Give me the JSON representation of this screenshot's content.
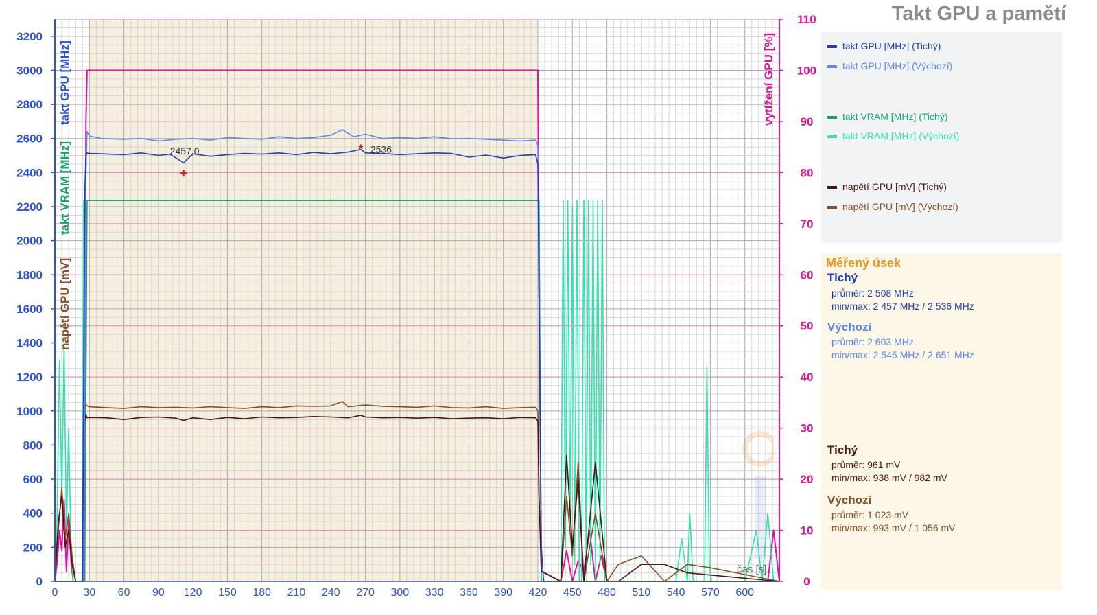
{
  "title": "Takt GPU a pamětí",
  "colors": {
    "quiet_clock": "#1f3fb0",
    "default_clock": "#5b85ef",
    "quiet_vram": "#16a06f",
    "default_vram": "#2ee3b0",
    "quiet_voltage": "#4a1410",
    "default_voltage": "#8a4d23",
    "utilization": "#e0129a",
    "left_axis": "#2a52d8",
    "right_axis": "#e0129a",
    "stats_heading": "#f0931e"
  },
  "legend": [
    {
      "label": "takt GPU [MHz] (Tichý)",
      "color": "#1f3fb0"
    },
    {
      "label": "takt GPU [MHz] (Výchozí)",
      "color": "#5b85ef"
    },
    {
      "label": "takt VRAM [MHz] (Tichý)",
      "color": "#16a06f"
    },
    {
      "label": "takt VRAM [MHz] (Výchozí)",
      "color": "#2ee3b0"
    },
    {
      "label": "napětí GPU [mV] (Tichý)",
      "color": "#4a1410"
    },
    {
      "label": "napětí GPU [mV] (Výchozí)",
      "color": "#8a4d23"
    }
  ],
  "stats": {
    "heading": "Měřený úsek",
    "clock_quiet": {
      "name": "Tichý",
      "avg": "průměr: 2 508 MHz",
      "minmax": "min/max: 2 457 MHz / 2 536 MHz"
    },
    "clock_default": {
      "name": "Výchozí",
      "avg": "průměr: 2 603 MHz",
      "minmax": "min/max: 2 545 MHz / 2 651 MHz"
    },
    "volt_quiet": {
      "name": "Tichý",
      "avg": "průměr: 961 mV",
      "minmax": "min/max: 938 mV / 982 mV"
    },
    "volt_default": {
      "name": "Výchozí",
      "avg": "průměr: 1 023 mV",
      "minmax": "min/max: 993 mV / 1 056 mV"
    }
  },
  "chart_data": {
    "type": "line",
    "x_label": "čas [s]",
    "xlim": [
      0,
      630
    ],
    "x_ticks": [
      0,
      30,
      60,
      90,
      120,
      150,
      180,
      210,
      240,
      270,
      300,
      330,
      360,
      390,
      420,
      450,
      480,
      510,
      540,
      570,
      600
    ],
    "y_left": {
      "labels": [
        "takt GPU [MHz]",
        "takt VRAM [MHz]",
        "napětí GPU [mV]"
      ],
      "ylim": [
        0,
        3300
      ],
      "ticks": [
        0,
        200,
        400,
        600,
        800,
        1000,
        1200,
        1400,
        1600,
        1800,
        2000,
        2200,
        2400,
        2600,
        2800,
        3000,
        3200
      ]
    },
    "y_right": {
      "label": "vytížení GPU [%]",
      "ylim": [
        0,
        110
      ],
      "ticks": [
        0,
        10,
        20,
        30,
        40,
        50,
        60,
        70,
        80,
        90,
        100,
        110
      ]
    },
    "measured_interval": [
      29,
      420
    ],
    "annotations": [
      {
        "text": "2457,0",
        "x": 112,
        "y": 2457
      },
      {
        "text": "2536",
        "x": 266,
        "y": 2536
      }
    ],
    "series": [
      {
        "name": "takt GPU [MHz] (Tichý)",
        "axis": "left",
        "x": [
          0,
          24,
          26,
          27,
          28,
          30,
          40,
          60,
          75,
          90,
          100,
          112,
          120,
          135,
          150,
          165,
          180,
          195,
          210,
          225,
          240,
          255,
          266,
          270,
          285,
          300,
          315,
          330,
          345,
          360,
          375,
          390,
          405,
          418,
          420,
          421,
          423,
          425,
          630
        ],
        "y": [
          0,
          0,
          2300,
          2500,
          2515,
          2512,
          2510,
          2505,
          2515,
          2500,
          2508,
          2457,
          2510,
          2495,
          2505,
          2512,
          2508,
          2515,
          2505,
          2518,
          2510,
          2520,
          2536,
          2515,
          2512,
          2505,
          2510,
          2515,
          2512,
          2490,
          2502,
          2485,
          2500,
          2505,
          2450,
          1700,
          200,
          0,
          0
        ]
      },
      {
        "name": "takt GPU [MHz] (Výchozí)",
        "axis": "left",
        "x": [
          0,
          25,
          27,
          28,
          30,
          40,
          60,
          75,
          90,
          105,
          120,
          135,
          150,
          165,
          180,
          195,
          210,
          225,
          240,
          250,
          260,
          270,
          285,
          300,
          315,
          330,
          345,
          360,
          375,
          390,
          405,
          418,
          420,
          421,
          423,
          425,
          630
        ],
        "y": [
          0,
          0,
          2400,
          2640,
          2615,
          2600,
          2595,
          2600,
          2585,
          2595,
          2600,
          2590,
          2605,
          2600,
          2595,
          2610,
          2600,
          2605,
          2620,
          2651,
          2610,
          2625,
          2600,
          2605,
          2600,
          2610,
          2598,
          2600,
          2595,
          2590,
          2585,
          2590,
          2560,
          1700,
          200,
          0,
          0
        ]
      },
      {
        "name": "takt VRAM [MHz] (Tichý)",
        "axis": "left",
        "x": [
          0,
          26,
          28,
          30,
          100,
          200,
          300,
          419,
          421,
          423,
          630
        ],
        "y": [
          0,
          0,
          2236,
          2236,
          2236,
          2236,
          2236,
          2236,
          2236,
          0,
          0
        ]
      },
      {
        "name": "takt VRAM [MHz] (Výchozí)",
        "axis": "left",
        "x": [
          0,
          2,
          4,
          6,
          8,
          10,
          12,
          14,
          16,
          18,
          24,
          25,
          27,
          28,
          30,
          419,
          421,
          423,
          440,
          442,
          444,
          446,
          448,
          450,
          452,
          454,
          456,
          458,
          460,
          462,
          464,
          466,
          468,
          470,
          472,
          474,
          476,
          478,
          480,
          540,
          545,
          550,
          552,
          555,
          560,
          565,
          567,
          569,
          571,
          575,
          600,
          610,
          615,
          620,
          625,
          630
        ],
        "y": [
          0,
          400,
          1300,
          500,
          1380,
          300,
          900,
          200,
          0,
          0,
          0,
          2236,
          2236,
          2236,
          2236,
          2236,
          2236,
          0,
          0,
          2236,
          200,
          2236,
          300,
          2200,
          100,
          2236,
          0,
          0,
          2236,
          50,
          2236,
          100,
          2236,
          0,
          2236,
          100,
          2236,
          0,
          0,
          0,
          250,
          0,
          400,
          0,
          0,
          0,
          1260,
          100,
          0,
          0,
          0,
          300,
          0,
          400,
          0,
          0
        ]
      },
      {
        "name": "napětí GPU [mV] (Tichý)",
        "axis": "left",
        "x": [
          0,
          3,
          6,
          9,
          12,
          15,
          18,
          24,
          25,
          27,
          28,
          30,
          45,
          60,
          75,
          90,
          105,
          112,
          120,
          135,
          150,
          165,
          180,
          195,
          210,
          225,
          240,
          255,
          266,
          270,
          285,
          300,
          315,
          330,
          345,
          360,
          375,
          390,
          405,
          418,
          420,
          421,
          423,
          440,
          445,
          450,
          455,
          460,
          470,
          480,
          490,
          510,
          530,
          550,
          630
        ],
        "y": [
          0,
          350,
          500,
          200,
          300,
          100,
          0,
          0,
          900,
          980,
          960,
          962,
          960,
          950,
          962,
          965,
          958,
          945,
          960,
          950,
          962,
          955,
          965,
          960,
          962,
          968,
          965,
          960,
          975,
          965,
          960,
          962,
          958,
          962,
          955,
          958,
          960,
          955,
          962,
          960,
          940,
          500,
          60,
          0,
          740,
          200,
          600,
          0,
          700,
          0,
          0,
          100,
          100,
          50,
          0
        ]
      },
      {
        "name": "napětí GPU [mV] (Výchozí)",
        "axis": "left",
        "x": [
          0,
          3,
          6,
          9,
          12,
          15,
          18,
          24,
          25,
          27,
          28,
          30,
          45,
          60,
          75,
          90,
          105,
          120,
          135,
          150,
          165,
          180,
          195,
          210,
          225,
          240,
          250,
          255,
          270,
          285,
          300,
          315,
          330,
          345,
          360,
          375,
          390,
          405,
          418,
          420,
          421,
          423,
          440,
          445,
          450,
          455,
          460,
          470,
          480,
          490,
          510,
          530,
          550,
          570,
          630
        ],
        "y": [
          0,
          300,
          550,
          250,
          400,
          150,
          0,
          0,
          1000,
          1040,
          1030,
          1025,
          1020,
          1015,
          1025,
          1020,
          1022,
          1018,
          1025,
          1020,
          1015,
          1025,
          1020,
          1030,
          1028,
          1030,
          1056,
          1025,
          1035,
          1028,
          1025,
          1022,
          1030,
          1020,
          1018,
          1025,
          1015,
          1020,
          1022,
          1000,
          500,
          60,
          0,
          500,
          150,
          700,
          0,
          400,
          0,
          100,
          150,
          0,
          100,
          80,
          0
        ]
      },
      {
        "name": "vytížení GPU [%]",
        "axis": "right",
        "x": [
          0,
          2,
          4,
          6,
          8,
          10,
          12,
          14,
          16,
          18,
          20,
          22,
          24,
          25,
          26,
          27,
          28,
          30,
          100,
          200,
          300,
          419,
          420,
          421,
          423,
          440,
          445,
          450,
          455,
          460,
          465,
          470,
          475,
          480,
          500,
          560,
          600,
          620,
          625,
          630
        ],
        "y": [
          0,
          4,
          10,
          6,
          16,
          2,
          12,
          4,
          0,
          0,
          0,
          0,
          0,
          5,
          30,
          90,
          100,
          100,
          100,
          100,
          100,
          100,
          100,
          60,
          2,
          0,
          6,
          0,
          4,
          2,
          10,
          0,
          5,
          0,
          0,
          0,
          0,
          0,
          10,
          0
        ]
      }
    ]
  }
}
